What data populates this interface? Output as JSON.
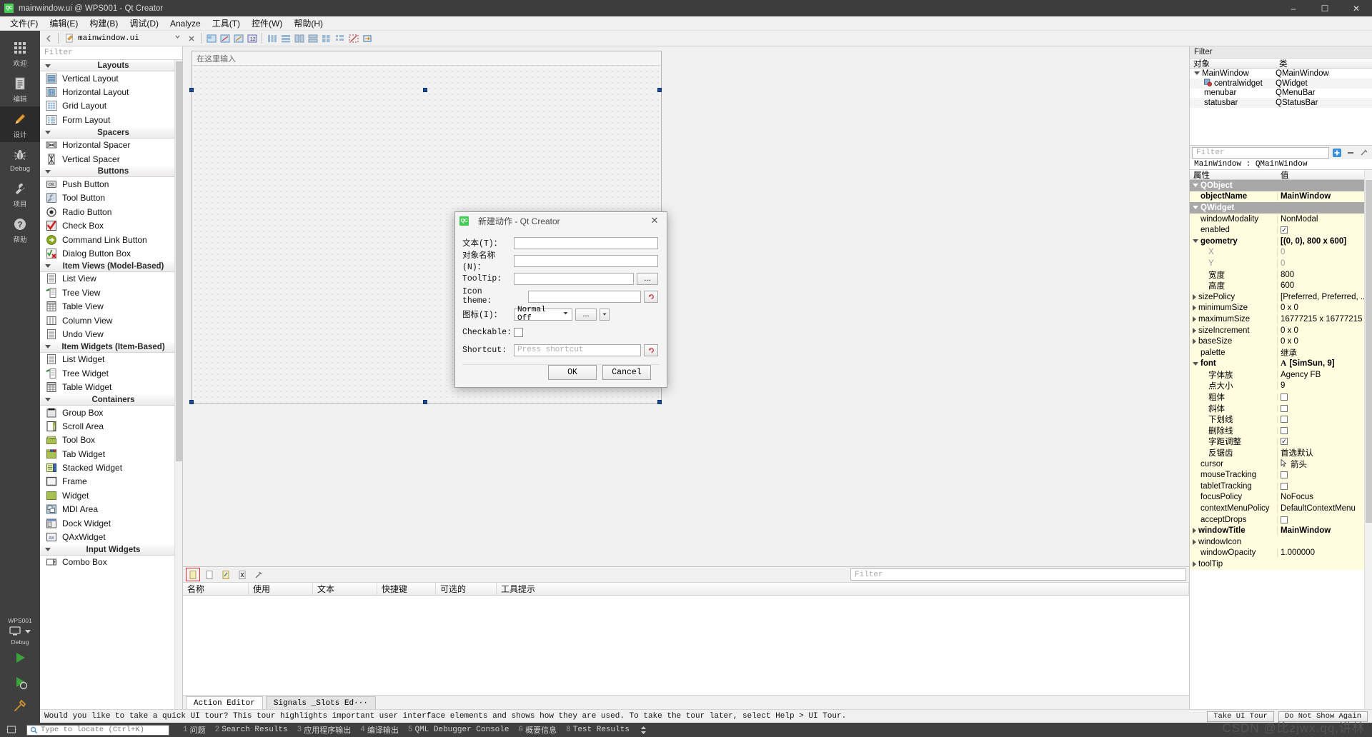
{
  "titlebar": {
    "logo": "QC",
    "title": "mainwindow.ui @ WPS001 - Qt Creator",
    "minimize": "–",
    "maximize": "☐",
    "close": "✕"
  },
  "menubar": {
    "items": [
      {
        "label": "文件(F)",
        "name": "menu-file"
      },
      {
        "label": "编辑(E)",
        "name": "menu-edit"
      },
      {
        "label": "构建(B)",
        "name": "menu-build"
      },
      {
        "label": "调试(D)",
        "name": "menu-debug"
      },
      {
        "label": "Analyze",
        "name": "menu-analyze"
      },
      {
        "label": "工具(T)",
        "name": "menu-tools"
      },
      {
        "label": "控件(W)",
        "name": "menu-window"
      },
      {
        "label": "帮助(H)",
        "name": "menu-help"
      }
    ]
  },
  "rail": {
    "items": [
      {
        "label": "欢迎",
        "icon": "grid-icon",
        "name": "mode-welcome"
      },
      {
        "label": "编辑",
        "icon": "document-icon",
        "name": "mode-edit"
      },
      {
        "label": "设计",
        "icon": "pencil-icon",
        "name": "mode-design"
      },
      {
        "label": "Debug",
        "icon": "bug-icon",
        "name": "mode-debug"
      },
      {
        "label": "项目",
        "icon": "wrench-icon",
        "name": "mode-projects"
      },
      {
        "label": "帮助",
        "icon": "question-icon",
        "name": "mode-help"
      }
    ],
    "kit": {
      "project": "WPS001",
      "config": "Debug"
    }
  },
  "editor_toolbar": {
    "file_name": "mainwindow.ui"
  },
  "widgetbox": {
    "filter_placeholder": "Filter",
    "groups": [
      {
        "title": "Layouts",
        "items": [
          {
            "label": "Vertical Layout",
            "icon": "vertical-layout-icon"
          },
          {
            "label": "Horizontal Layout",
            "icon": "horizontal-layout-icon"
          },
          {
            "label": "Grid Layout",
            "icon": "grid-layout-icon"
          },
          {
            "label": "Form Layout",
            "icon": "form-layout-icon"
          }
        ]
      },
      {
        "title": "Spacers",
        "items": [
          {
            "label": "Horizontal Spacer",
            "icon": "horizontal-spacer-icon"
          },
          {
            "label": "Vertical Spacer",
            "icon": "vertical-spacer-icon"
          }
        ]
      },
      {
        "title": "Buttons",
        "items": [
          {
            "label": "Push Button",
            "icon": "push-button-icon"
          },
          {
            "label": "Tool Button",
            "icon": "tool-button-icon"
          },
          {
            "label": "Radio Button",
            "icon": "radio-button-icon"
          },
          {
            "label": "Check Box",
            "icon": "check-box-icon"
          },
          {
            "label": "Command Link Button",
            "icon": "command-link-icon"
          },
          {
            "label": "Dialog Button Box",
            "icon": "dialog-button-box-icon"
          }
        ]
      },
      {
        "title": "Item Views (Model-Based)",
        "items": [
          {
            "label": "List View",
            "icon": "list-view-icon"
          },
          {
            "label": "Tree View",
            "icon": "tree-view-icon"
          },
          {
            "label": "Table View",
            "icon": "table-view-icon"
          },
          {
            "label": "Column View",
            "icon": "column-view-icon"
          },
          {
            "label": "Undo View",
            "icon": "undo-view-icon"
          }
        ]
      },
      {
        "title": "Item Widgets (Item-Based)",
        "items": [
          {
            "label": "List Widget",
            "icon": "list-widget-icon"
          },
          {
            "label": "Tree Widget",
            "icon": "tree-widget-icon"
          },
          {
            "label": "Table Widget",
            "icon": "table-widget-icon"
          }
        ]
      },
      {
        "title": "Containers",
        "items": [
          {
            "label": "Group Box",
            "icon": "group-box-icon"
          },
          {
            "label": "Scroll Area",
            "icon": "scroll-area-icon"
          },
          {
            "label": "Tool Box",
            "icon": "tool-box-icon"
          },
          {
            "label": "Tab Widget",
            "icon": "tab-widget-icon"
          },
          {
            "label": "Stacked Widget",
            "icon": "stacked-widget-icon"
          },
          {
            "label": "Frame",
            "icon": "frame-icon"
          },
          {
            "label": "Widget",
            "icon": "widget-icon"
          },
          {
            "label": "MDI Area",
            "icon": "mdi-area-icon"
          },
          {
            "label": "Dock Widget",
            "icon": "dock-widget-icon"
          },
          {
            "label": "QAxWidget",
            "icon": "qax-widget-icon"
          }
        ]
      },
      {
        "title": "Input Widgets",
        "items": [
          {
            "label": "Combo Box",
            "icon": "combo-box-icon"
          }
        ]
      }
    ]
  },
  "form": {
    "menubar_hint": "在这里输入"
  },
  "dialog": {
    "logo": "QC",
    "title": "新建动作 - Qt Creator",
    "close": "✕",
    "fields": {
      "text_label": "文本(T)：",
      "text_value": "",
      "object_name_label": "对象名称(N)：",
      "object_name_value": "",
      "tooltip_label": "ToolTip:",
      "tooltip_value": "",
      "tooltip_browse": "...",
      "icon_theme_label": "Icon theme:",
      "icon_theme_value": "",
      "icon_label": "图标(I)：",
      "icon_state": "Normal Off",
      "icon_browse": "...",
      "checkable_label": "Checkable:",
      "shortcut_label": "Shortcut:",
      "shortcut_placeholder": "Press shortcut"
    },
    "buttons": {
      "ok": "OK",
      "cancel": "Cancel"
    }
  },
  "action_editor": {
    "filter_placeholder": "Filter",
    "columns": [
      "名称",
      "使用",
      "文本",
      "快捷键",
      "可选的",
      "工具提示"
    ],
    "rows": [],
    "tabs": [
      {
        "label": "Action Editor",
        "active": true
      },
      {
        "label": "Signals _Slots Ed···",
        "active": false
      }
    ],
    "toolbar_icons": [
      "new-action-icon",
      "copy-action-icon",
      "edit-action-icon",
      "delete-action-icon",
      "configure-icon"
    ]
  },
  "object_inspector": {
    "dock_title": "Filter",
    "filter_placeholder": "Filter",
    "columns": [
      "对象",
      "类"
    ],
    "rows": [
      {
        "object": "MainWindow",
        "class": "QMainWindow",
        "indent": 0,
        "expander": true,
        "icon": ""
      },
      {
        "object": "centralwidget",
        "class": "QWidget",
        "indent": 1,
        "expander": false,
        "icon": "central-widget-icon"
      },
      {
        "object": "menubar",
        "class": "QMenuBar",
        "indent": 1,
        "expander": false,
        "icon": ""
      },
      {
        "object": "statusbar",
        "class": "QStatusBar",
        "indent": 1,
        "expander": false,
        "icon": ""
      }
    ]
  },
  "property_editor": {
    "filter_placeholder": "Filter",
    "object_line": "MainWindow : QMainWindow",
    "columns": [
      "属性",
      "值"
    ],
    "rows": [
      {
        "name": "QObject",
        "value": "",
        "type": "group",
        "expander": "down",
        "indent": 0
      },
      {
        "name": "objectName",
        "value": "MainWindow",
        "type": "bold",
        "indent": 1
      },
      {
        "name": "QWidget",
        "value": "",
        "type": "group",
        "expander": "down",
        "indent": 0
      },
      {
        "name": "windowModality",
        "value": "NonModal",
        "type": "normal",
        "indent": 1
      },
      {
        "name": "enabled",
        "value": "",
        "type": "check-on",
        "indent": 1
      },
      {
        "name": "geometry",
        "value": "[(0, 0), 800 x 600]",
        "type": "bold",
        "expander": "down",
        "indent": 0
      },
      {
        "name": "X",
        "value": "0",
        "type": "dim",
        "indent": 2
      },
      {
        "name": "Y",
        "value": "0",
        "type": "dim",
        "indent": 2
      },
      {
        "name": "宽度",
        "value": "800",
        "type": "normal",
        "indent": 2
      },
      {
        "name": "高度",
        "value": "600",
        "type": "normal",
        "indent": 2
      },
      {
        "name": "sizePolicy",
        "value": "[Preferred, Preferred, ...",
        "type": "normal",
        "expander": "right",
        "indent": 0
      },
      {
        "name": "minimumSize",
        "value": "0 x 0",
        "type": "normal",
        "expander": "right",
        "indent": 0
      },
      {
        "name": "maximumSize",
        "value": "16777215 x 16777215",
        "type": "normal",
        "expander": "right",
        "indent": 0
      },
      {
        "name": "sizeIncrement",
        "value": "0 x 0",
        "type": "normal",
        "expander": "right",
        "indent": 0
      },
      {
        "name": "baseSize",
        "value": "0 x 0",
        "type": "normal",
        "expander": "right",
        "indent": 0
      },
      {
        "name": "palette",
        "value": "继承",
        "type": "normal",
        "indent": 1
      },
      {
        "name": "font",
        "value": "[SimSun, 9]",
        "type": "bold",
        "expander": "down",
        "indent": 0,
        "value_icon": "font-A-icon"
      },
      {
        "name": "字体族",
        "value": "Agency FB",
        "type": "normal",
        "indent": 2
      },
      {
        "name": "点大小",
        "value": "9",
        "type": "normal",
        "indent": 2
      },
      {
        "name": "粗体",
        "value": "",
        "type": "check-off",
        "indent": 2
      },
      {
        "name": "斜体",
        "value": "",
        "type": "check-off",
        "indent": 2
      },
      {
        "name": "下划线",
        "value": "",
        "type": "check-off",
        "indent": 2
      },
      {
        "name": "删除线",
        "value": "",
        "type": "check-off",
        "indent": 2
      },
      {
        "name": "字距调整",
        "value": "",
        "type": "check-on",
        "indent": 2
      },
      {
        "name": "反锯齿",
        "value": "首选默认",
        "type": "normal",
        "indent": 2
      },
      {
        "name": "cursor",
        "value": "箭头",
        "type": "normal",
        "indent": 1,
        "value_icon": "cursor-arrow-icon"
      },
      {
        "name": "mouseTracking",
        "value": "",
        "type": "check-off",
        "indent": 1
      },
      {
        "name": "tabletTracking",
        "value": "",
        "type": "check-off",
        "indent": 1
      },
      {
        "name": "focusPolicy",
        "value": "NoFocus",
        "type": "normal",
        "indent": 1
      },
      {
        "name": "contextMenuPolicy",
        "value": "DefaultContextMenu",
        "type": "normal",
        "indent": 1
      },
      {
        "name": "acceptDrops",
        "value": "",
        "type": "check-off",
        "indent": 1
      },
      {
        "name": "windowTitle",
        "value": "MainWindow",
        "type": "bold",
        "expander": "right",
        "indent": 0
      },
      {
        "name": "windowIcon",
        "value": "",
        "type": "normal",
        "expander": "right",
        "indent": 0
      },
      {
        "name": "windowOpacity",
        "value": "1.000000",
        "type": "normal",
        "indent": 1
      },
      {
        "name": "toolTip",
        "value": "",
        "type": "normal",
        "expander": "right",
        "indent": 0
      }
    ]
  },
  "tour": {
    "message": "Would you like to take a quick UI tour? This tour highlights important user interface elements and shows how they are used. To take the tour later, select Help > UI Tour.",
    "take_tour": "Take UI Tour",
    "do_not_show": "Do Not Show Again"
  },
  "statusbar": {
    "locator_placeholder": "Type to locate (Ctrl+K)",
    "items": [
      {
        "num": "1",
        "label": "问题"
      },
      {
        "num": "2",
        "label": "Search Results"
      },
      {
        "num": "3",
        "label": "应用程序输出"
      },
      {
        "num": "4",
        "label": "编译输出"
      },
      {
        "num": "5",
        "label": "QML Debugger Console"
      },
      {
        "num": "6",
        "label": "概要信息"
      },
      {
        "num": "8",
        "label": "Test Results"
      }
    ]
  },
  "watermark": "CSDN @比zjwx.qq,讲林",
  "colors": {
    "accent_green": "#41cd52",
    "rail_bg": "#3f3f3f",
    "property_yellow": "#fffce0",
    "selection_blue": "#1a4d9e",
    "highlight_red": "#e03030"
  }
}
